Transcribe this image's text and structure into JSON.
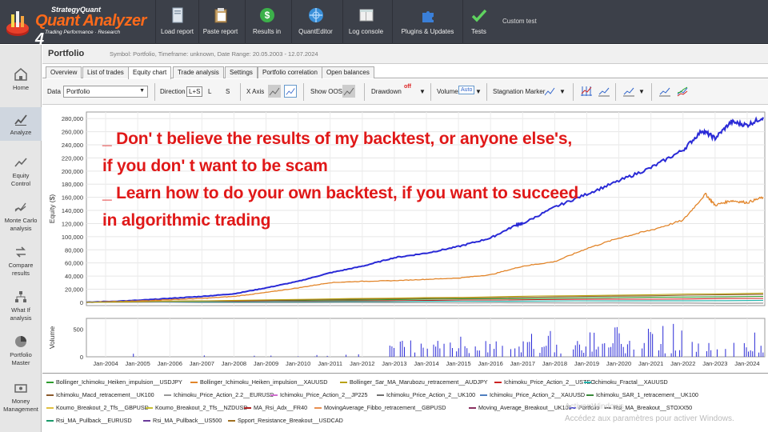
{
  "app": {
    "brand_small": "StrategyQuant",
    "brand_name": "Quant Analyzer",
    "brand_version": "4",
    "brand_tagline": "Trading Performance · Research"
  },
  "toolbar": {
    "buttons": [
      {
        "label": "Load report",
        "icon": "file-icon"
      },
      {
        "label": "Paste report",
        "icon": "clipboard-icon"
      },
      {
        "label": "Results in",
        "icon": "dollar-icon"
      },
      {
        "label": "QuantEditor",
        "icon": "globe-icon"
      },
      {
        "label": "Log console",
        "icon": "console-icon"
      },
      {
        "label": "Plugins & Updates",
        "icon": "puzzle-icon"
      },
      {
        "label": "Tests",
        "icon": "check-icon"
      }
    ],
    "custom_test": "Custom test"
  },
  "sidenav": {
    "items": [
      {
        "label": "Home",
        "icon": "home-icon"
      },
      {
        "label": "Analyze",
        "icon": "analyze-icon"
      },
      {
        "label": "Equity Control",
        "icon": "equity-control-icon"
      },
      {
        "label": "Monte Carlo analysis",
        "icon": "monte-carlo-icon"
      },
      {
        "label": "Compare results",
        "icon": "compare-icon"
      },
      {
        "label": "What If analysis",
        "icon": "what-if-icon"
      },
      {
        "label": "Portfolio Master",
        "icon": "pie-icon"
      },
      {
        "label": "Money Management",
        "icon": "money-icon"
      }
    ],
    "active": "Analyze"
  },
  "portfolio": {
    "title": "Portfolio",
    "info": "Symbol: Portfolio, Timeframe: unknown, Date Range: 20.05.2003 - 12.07.2024"
  },
  "tabs": [
    "Overview",
    "List of trades",
    "Equity chart",
    "Trade analysis",
    "Settings",
    "Portfolio correlation",
    "Open balances"
  ],
  "active_tab": "Equity chart",
  "settings": {
    "data_label": "Data",
    "data_value": "Portfolio",
    "direction_label": "Direction",
    "direction_options": [
      "L+S",
      "L",
      "S"
    ],
    "xaxis_label": "X Axis",
    "show_oos_label": "Show OOS",
    "drawdown_label": "Drawdown",
    "drawdown_badge": "off",
    "volume_label": "Volume",
    "volume_badge": "Auto",
    "stagnation_label": "Stagnation Marker"
  },
  "chart_data": {
    "type": "line",
    "ylabel": "Equity ($)",
    "volume_label": "Volume",
    "y_ticks": [
      0,
      20000,
      40000,
      60000,
      80000,
      100000,
      120000,
      140000,
      160000,
      180000,
      200000,
      220000,
      240000,
      260000,
      280000
    ],
    "y_tick_labels": [
      "0",
      "20,000",
      "40,000",
      "60,000",
      "80,000",
      "100,000",
      "120,000",
      "140,000",
      "160,000",
      "180,000",
      "200,000",
      "220,000",
      "240,000",
      "260,000",
      "280,000"
    ],
    "ylim": [
      -5000,
      290000
    ],
    "x_tick_labels": [
      "Jan-2004",
      "Jan-2005",
      "Jan-2006",
      "Jan-2007",
      "Jan-2008",
      "Jan-2009",
      "Jan-2010",
      "Jan-2011",
      "Jan-2012",
      "Jan-2013",
      "Jan-2014",
      "Jan-2015",
      "Jan-2016",
      "Jan-2017",
      "Jan-2018",
      "Jan-2019",
      "Jan-2020",
      "Jan-2021",
      "Jan-2022",
      "Jan-2023",
      "Jan-2024"
    ],
    "xlim": [
      2003.4,
      2024.55
    ],
    "volume_ticks": [
      0,
      500
    ],
    "volume_tick_labels": [
      "0",
      "500"
    ],
    "series": [
      {
        "color": "#2a2ad6",
        "x": [
          2003.4,
          2005,
          2006,
          2007,
          2008,
          2009,
          2010,
          2011,
          2012,
          2013,
          2014,
          2015,
          2016,
          2016.8,
          2017,
          2018,
          2019,
          2020,
          2021,
          2022,
          2022.6,
          2023,
          2023.5,
          2024,
          2024.5
        ],
        "y": [
          0,
          3000,
          6000,
          9000,
          13000,
          22000,
          32000,
          45000,
          55000,
          68000,
          75000,
          85000,
          98000,
          118000,
          120000,
          145000,
          165000,
          185000,
          205000,
          232000,
          262000,
          250000,
          275000,
          270000,
          282000
        ]
      },
      {
        "color": "#e2852a",
        "x": [
          2003.4,
          2005,
          2006,
          2007,
          2008,
          2009,
          2010,
          2011,
          2012,
          2013,
          2014,
          2015,
          2016,
          2017,
          2018,
          2019,
          2020,
          2021,
          2022,
          2022.7,
          2023,
          2023.5,
          2024,
          2024.5
        ],
        "y": [
          0,
          2000,
          4000,
          6000,
          9000,
          15000,
          22000,
          30000,
          32000,
          33000,
          35000,
          37000,
          42000,
          55000,
          62000,
          82000,
          98000,
          110000,
          125000,
          165000,
          148000,
          155000,
          152000,
          160000
        ]
      },
      {
        "color": "#2e9c2e",
        "x": [
          2003.4,
          2024.5
        ],
        "y": [
          0,
          9000
        ]
      },
      {
        "color": "#cc2222",
        "x": [
          2003.4,
          2024.5
        ],
        "y": [
          0,
          6000
        ]
      },
      {
        "color": "#8b5a2b",
        "x": [
          2003.4,
          2024.5
        ],
        "y": [
          0,
          12000
        ]
      },
      {
        "color": "#20b2aa",
        "x": [
          2003.4,
          2024.5
        ],
        "y": [
          0,
          3000
        ]
      },
      {
        "color": "#999999",
        "x": [
          2003.4,
          2024.5
        ],
        "y": [
          0,
          -1500
        ]
      },
      {
        "color": "#b9a10f",
        "x": [
          2003.4,
          2024.5
        ],
        "y": [
          0,
          14000
        ]
      }
    ]
  },
  "legend": [
    {
      "name": "Bollinger_Ichimoku_Heiken_impulsion__USDJPY",
      "color": "#2e9c2e"
    },
    {
      "name": "Bollinger_Ichimoku_Heiken_impulsion__XAUUSD",
      "color": "#e2852a"
    },
    {
      "name": "Bollinger_Sar_MA_Marubozu_retracement__AUDJPY",
      "color": "#b9a10f"
    },
    {
      "name": "Ichimoku_Price_Action_2__USTEC",
      "color": "#cc2222"
    },
    {
      "name": "Ichimoku_Fractal__XAUUSD",
      "color": "#20b2aa"
    },
    {
      "name": "Ichimoku_Macd_retracement__UK100",
      "color": "#8b5a2b"
    },
    {
      "name": "Ichimoku_Price_Action_2.2__EURUSD",
      "color": "#999999"
    },
    {
      "name": "Ichimoku_Price_Action_2__JP225",
      "color": "#d070d0"
    },
    {
      "name": "Ichimoku_Price_Action_2__UK100",
      "color": "#707070"
    },
    {
      "name": "Ichimoku_Price_Action_2__XAUUSD",
      "color": "#4f7fbf"
    },
    {
      "name": "Ichimoku_SAR_1_retracement__UK100",
      "color": "#3a8a3a"
    },
    {
      "name": "Koumo_Breakout_2_Tfs__GBPUSD",
      "color": "#e0c040"
    },
    {
      "name": "Koumo_Breakout_2_Tfs__NZDUSD",
      "color": "#c8c030"
    },
    {
      "name": "MA_Rsi_Adx__FR40",
      "color": "#b02020"
    },
    {
      "name": "MovingAverage_Fibbo_retracement__GBPUSD",
      "color": "#e89050"
    },
    {
      "name": "Moving_Average_Breakout__UK100",
      "color": "#8a3060"
    },
    {
      "name": "Portfolio",
      "color": "#2a2ad6"
    },
    {
      "name": "Rsi_MA_Breakout__STOXX50",
      "color": "#5a5a5a"
    },
    {
      "name": "Rsi_MA_Pullback__EURUSD",
      "color": "#1a9a6a"
    },
    {
      "name": "Rsi_MA_Pullback__US500",
      "color": "#6a3a9a"
    },
    {
      "name": "Spport_Resistance_Breakout__USDCAD",
      "color": "#a07020"
    }
  ],
  "overlay_text": [
    "_  Don' t believe the results of my backtest, or anyone else's,",
    "if you don' t want to be scam",
    "_  Learn how to do your own backtest, if you want to succeed",
    "in algorithmic trading"
  ],
  "watermark": {
    "line1": "Activer Windows",
    "line2": "Accédez aux paramètres pour activer Windows."
  },
  "colors": {
    "toolbar_bg": "#3c4049",
    "overlay_red": "#e01818",
    "portfolio_line": "#2a2ad6",
    "volume_bar": "#2a2ad6"
  }
}
